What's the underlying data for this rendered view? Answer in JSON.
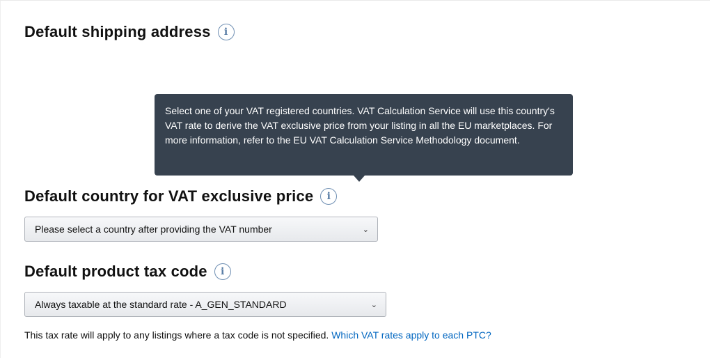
{
  "shipping": {
    "heading": "Default shipping address"
  },
  "tooltip": {
    "text": "Select one of your VAT registered countries. VAT Calculation Service will use this country's VAT rate to derive the VAT exclusive price from your listing in all the EU marketplaces. For more information, refer to the EU VAT Calculation Service Methodology document."
  },
  "vat_country": {
    "heading": "Default country for VAT exclusive price",
    "select_value": "Please select a country after providing the VAT number"
  },
  "tax_code": {
    "heading": "Default product tax code",
    "select_value": "Always taxable at the standard rate - A_GEN_STANDARD",
    "help_text": "This tax rate will apply to any listings where a tax code is not specified.",
    "help_link": "Which VAT rates apply to each PTC?"
  },
  "icons": {
    "info": "info-icon",
    "chevron": "chevron-down-icon"
  },
  "colors": {
    "tooltip_bg": "#37424f",
    "link": "#0066c0",
    "info_icon": "#6f8fb3"
  }
}
